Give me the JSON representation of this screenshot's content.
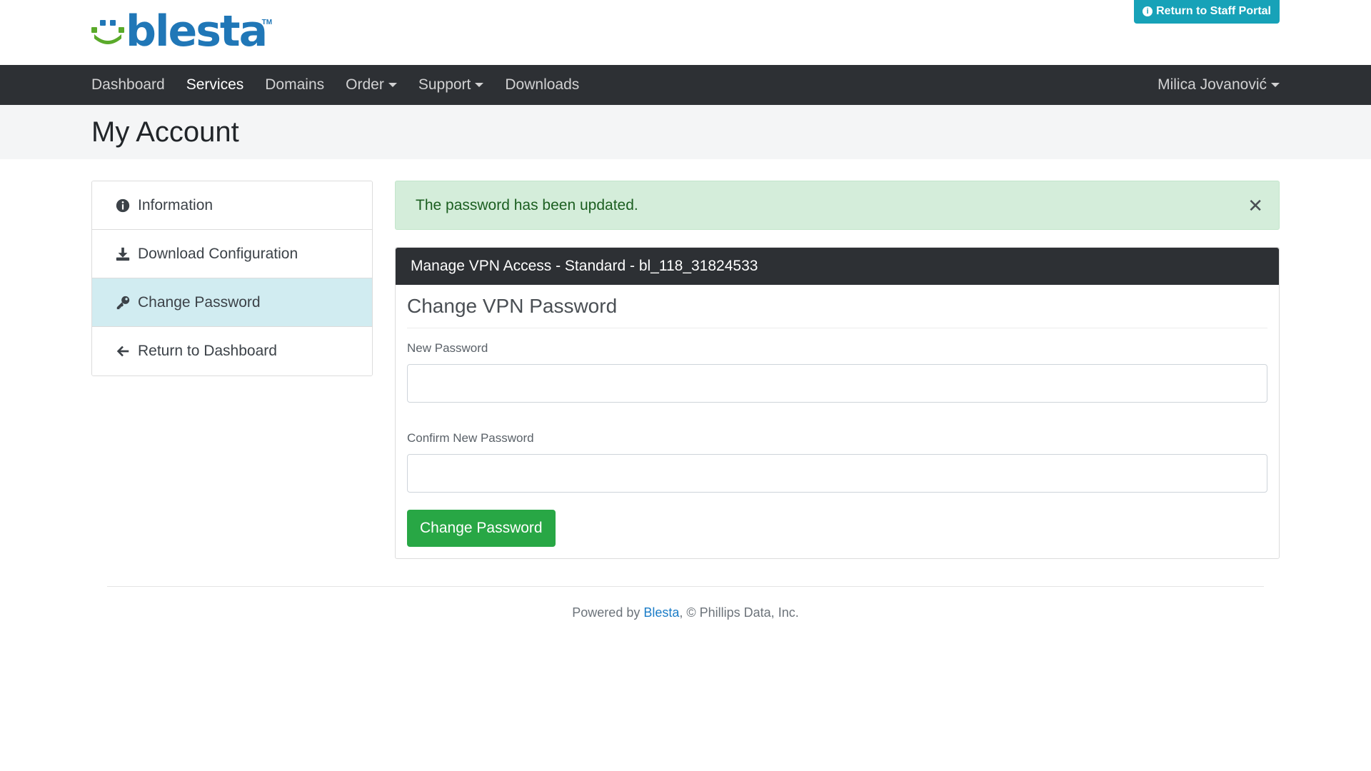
{
  "header": {
    "logo_text": "blesta",
    "logo_tm": "TM",
    "staff_portal_label": "Return to Staff Portal"
  },
  "nav": {
    "items": [
      {
        "label": "Dashboard"
      },
      {
        "label": "Services"
      },
      {
        "label": "Domains"
      },
      {
        "label": "Order"
      },
      {
        "label": "Support"
      },
      {
        "label": "Downloads"
      }
    ],
    "user_name": "Milica Jovanović"
  },
  "page": {
    "title": "My Account"
  },
  "sidebar": {
    "items": [
      {
        "label": "Information",
        "icon": "info-circle-icon"
      },
      {
        "label": "Download Configuration",
        "icon": "download-icon"
      },
      {
        "label": "Change Password",
        "icon": "key-icon"
      },
      {
        "label": "Return to Dashboard",
        "icon": "arrow-left-icon"
      }
    ]
  },
  "alert": {
    "message": "The password has been updated.",
    "close": "✕"
  },
  "panel": {
    "heading": "Manage VPN Access - Standard - bl_118_31824533",
    "title": "Change VPN Password",
    "new_password_label": "New Password",
    "new_password_value": "",
    "confirm_password_label": "Confirm New Password",
    "confirm_password_value": "",
    "submit_label": "Change Password"
  },
  "footer": {
    "prefix": "Powered by ",
    "link": "Blesta",
    "suffix": ", © Phillips Data, Inc."
  },
  "colors": {
    "navbar": "#2d3034",
    "staff_button": "#17a2b8",
    "success_button": "#28a745",
    "alert_bg": "#d4edda",
    "active_sidebar": "#d1ecf1",
    "logo_blue": "#2077b7",
    "logo_green": "#5aaa2a"
  }
}
